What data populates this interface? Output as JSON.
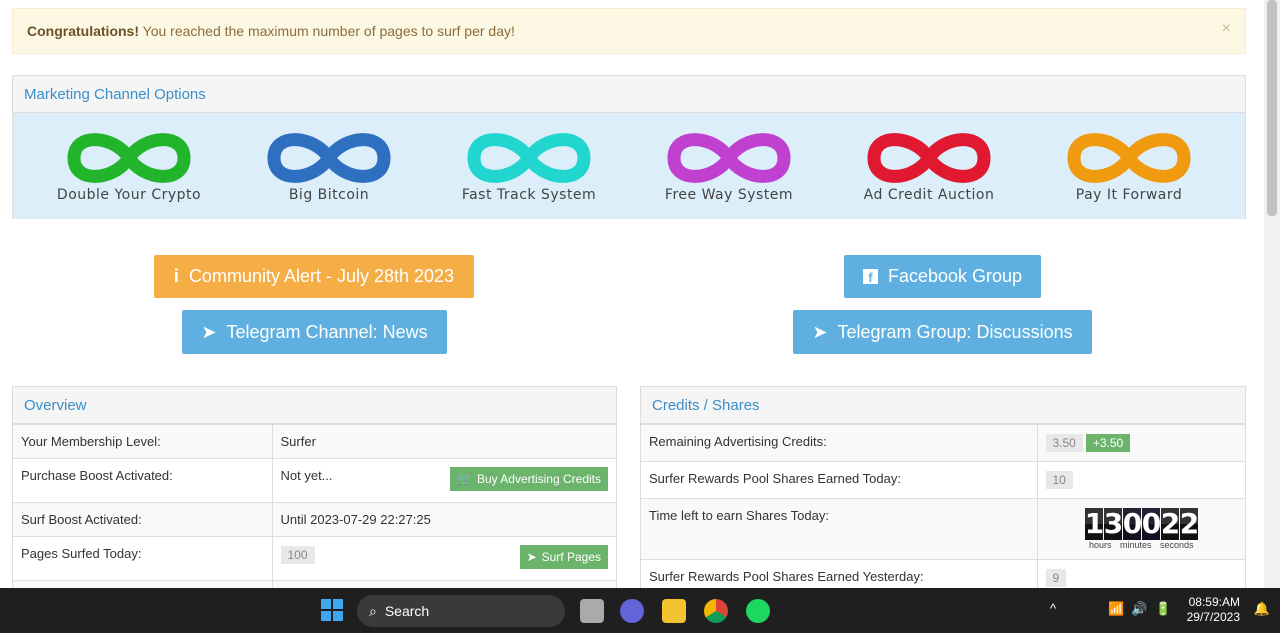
{
  "alert": {
    "strong": "Congratulations!",
    "text": " You reached the maximum number of pages to surf per day!",
    "close": "×"
  },
  "marketing": {
    "title": "Marketing Channel Options",
    "channels": [
      {
        "label": "Double Your Crypto",
        "color": "#22b52c"
      },
      {
        "label": "Big Bitcoin",
        "color": "#2f6fc0"
      },
      {
        "label": "Fast Track System",
        "color": "#22d6d0"
      },
      {
        "label": "Free Way System",
        "color": "#c040d0"
      },
      {
        "label": "Ad Credit Auction",
        "color": "#e01830"
      },
      {
        "label": "Pay It Forward",
        "color": "#f09a10"
      }
    ]
  },
  "links": {
    "community": "Community Alert - July 28th 2023",
    "facebook": "Facebook Group",
    "telegram_news": "Telegram Channel: News",
    "telegram_group": "Telegram Group: Discussions"
  },
  "overview": {
    "title": "Overview",
    "rows": [
      {
        "label": "Your Membership Level:",
        "value": "Surfer"
      },
      {
        "label": "Purchase Boost Activated:",
        "value": "Not yet...",
        "button": "Buy Advertising Credits"
      },
      {
        "label": "Surf Boost Activated:",
        "value": "Until 2023-07-29 22:27:25"
      },
      {
        "label": "Pages Surfed Today:",
        "value": "100",
        "button": "Surf Pages"
      }
    ]
  },
  "credits": {
    "title": "Credits / Shares",
    "rows": [
      {
        "label": "Remaining Advertising Credits:",
        "value": "3.50",
        "delta": "+3.50"
      },
      {
        "label": "Surfer Rewards Pool Shares Earned Today:",
        "value": "10"
      },
      {
        "label": "Time left to earn Shares Today:",
        "digits": [
          "1",
          "3",
          "0",
          "0",
          "2",
          "2"
        ],
        "units": "hours minutes seconds"
      },
      {
        "label": "Surfer Rewards Pool Shares Earned Yesterday:",
        "value": "9"
      }
    ]
  },
  "taskbar": {
    "search": "Search",
    "time": "08:59:AM",
    "date": "29/7/2023"
  }
}
